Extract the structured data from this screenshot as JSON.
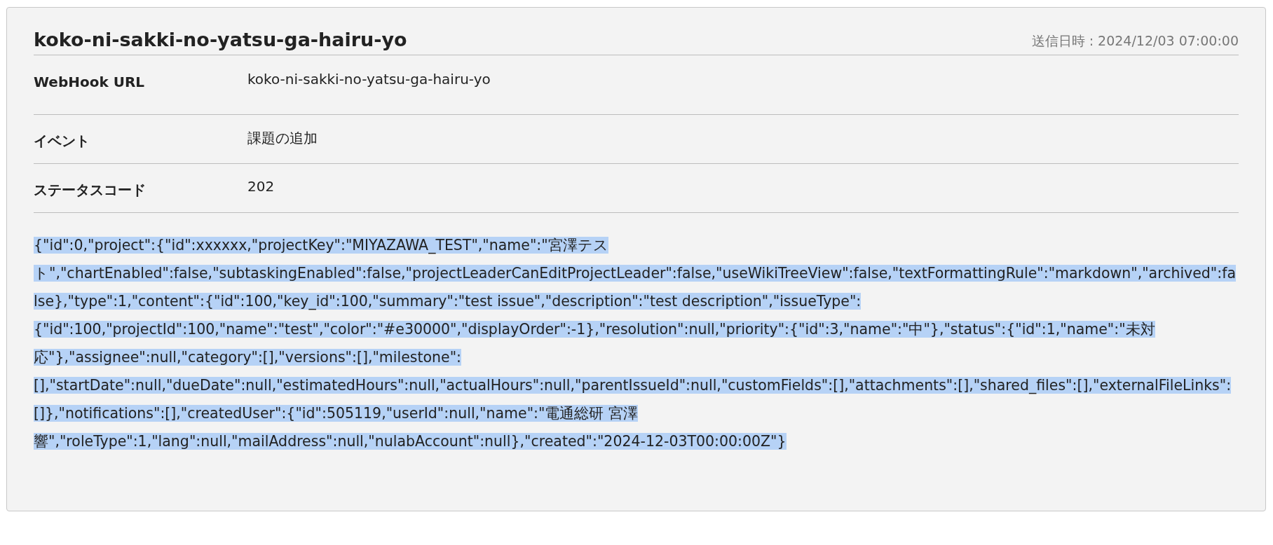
{
  "header": {
    "title": "koko-ni-sakki-no-yatsu-ga-hairu-yo",
    "sent_at": "送信日時 : 2024/12/03 07:00:00"
  },
  "fields": [
    {
      "label": "WebHook URL",
      "value": "koko-ni-sakki-no-yatsu-ga-hairu-yo"
    },
    {
      "label": "イベント",
      "value": "課題の追加"
    },
    {
      "label": "ステータスコード",
      "value": "202"
    }
  ],
  "payload": {
    "text": "{\"id\":0,\"project\":{\"id\":xxxxxx,\"projectKey\":\"MIYAZAWA_TEST\",\"name\":\"宮澤テスト\",\"chartEnabled\":false,\"subtaskingEnabled\":false,\"projectLeaderCanEditProjectLeader\":false,\"useWikiTreeView\":false,\"textFormattingRule\":\"markdown\",\"archived\":false},\"type\":1,\"content\":{\"id\":100,\"key_id\":100,\"summary\":\"test issue\",\"description\":\"test description\",\"issueType\":{\"id\":100,\"projectId\":100,\"name\":\"test\",\"color\":\"#e30000\",\"displayOrder\":-1},\"resolution\":null,\"priority\":{\"id\":3,\"name\":\"中\"},\"status\":{\"id\":1,\"name\":\"未対応\"},\"assignee\":null,\"category\":[],\"versions\":[],\"milestone\":[],\"startDate\":null,\"dueDate\":null,\"estimatedHours\":null,\"actualHours\":null,\"parentIssueId\":null,\"customFields\":[],\"attachments\":[],\"shared_files\":[],\"externalFileLinks\":[]},\"notifications\":[],\"createdUser\":{\"id\":505119,\"userId\":null,\"name\":\"電通総研 宮澤響\",\"roleType\":1,\"lang\":null,\"mailAddress\":null,\"nulabAccount\":null},\"created\":\"2024-12-03T00:00:00Z\"}",
    "selected": true
  }
}
